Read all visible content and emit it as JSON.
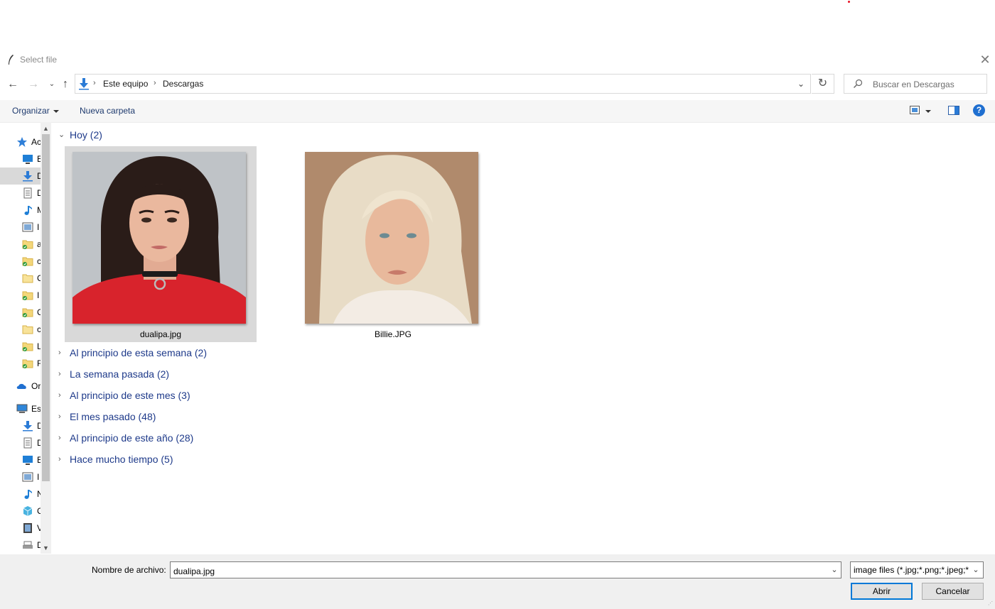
{
  "window": {
    "title": "Select file"
  },
  "address": {
    "crumbs": [
      "Este equipo",
      "Descargas"
    ],
    "separator": "›"
  },
  "search": {
    "placeholder": "Buscar en Descargas"
  },
  "toolbar": {
    "organize": "Organizar",
    "new_folder": "Nueva carpeta",
    "help": "?"
  },
  "sidebar": {
    "items": [
      {
        "label": "Ac",
        "icon": "star-icon"
      },
      {
        "label": "E",
        "icon": "desktop-icon"
      },
      {
        "label": "D",
        "icon": "download-icon",
        "selected": true
      },
      {
        "label": "D",
        "icon": "document-icon"
      },
      {
        "label": "M",
        "icon": "music-icon"
      },
      {
        "label": "I",
        "icon": "image-icon"
      },
      {
        "label": "a",
        "icon": "synced-folder-icon"
      },
      {
        "label": "c",
        "icon": "synced-folder-icon"
      },
      {
        "label": "C",
        "icon": "folder-icon"
      },
      {
        "label": "I",
        "icon": "synced-folder-icon"
      },
      {
        "label": "C",
        "icon": "synced-folder-icon"
      },
      {
        "label": "c",
        "icon": "folder-icon"
      },
      {
        "label": "L",
        "icon": "synced-folder-icon"
      },
      {
        "label": "F",
        "icon": "synced-folder-icon"
      },
      {
        "label": "Or",
        "icon": "onedrive-icon"
      },
      {
        "label": "Es",
        "icon": "computer-icon"
      },
      {
        "label": "D",
        "icon": "download-icon"
      },
      {
        "label": "D",
        "icon": "document-icon"
      },
      {
        "label": "E",
        "icon": "desktop-icon"
      },
      {
        "label": "I",
        "icon": "image-icon"
      },
      {
        "label": "N",
        "icon": "music-icon"
      },
      {
        "label": "C",
        "icon": "3d-objects-icon"
      },
      {
        "label": "V",
        "icon": "video-icon"
      },
      {
        "label": "D",
        "icon": "drive-icon"
      }
    ]
  },
  "groups": [
    {
      "label": "Hoy (2)",
      "expanded": true
    },
    {
      "label": "Al principio de esta semana (2)",
      "expanded": false
    },
    {
      "label": "La semana pasada (2)",
      "expanded": false
    },
    {
      "label": "Al principio de este mes (3)",
      "expanded": false
    },
    {
      "label": "El mes pasado (48)",
      "expanded": false
    },
    {
      "label": "Al principio de este año (28)",
      "expanded": false
    },
    {
      "label": "Hace mucho tiempo (5)",
      "expanded": false
    }
  ],
  "files": [
    {
      "name": "dualipa.jpg",
      "selected": true
    },
    {
      "name": "Billie.JPG",
      "selected": false
    }
  ],
  "bottom": {
    "filename_label": "Nombre de archivo:",
    "filename_value": "dualipa.jpg",
    "filetype": "image files (*.jpg;*.png;*.jpeg;*",
    "open_label": "Abrir",
    "cancel_label": "Cancelar"
  },
  "colors": {
    "accent": "#0078d7",
    "group_text": "#1e3a8a",
    "selection": "#d9d9d9"
  }
}
